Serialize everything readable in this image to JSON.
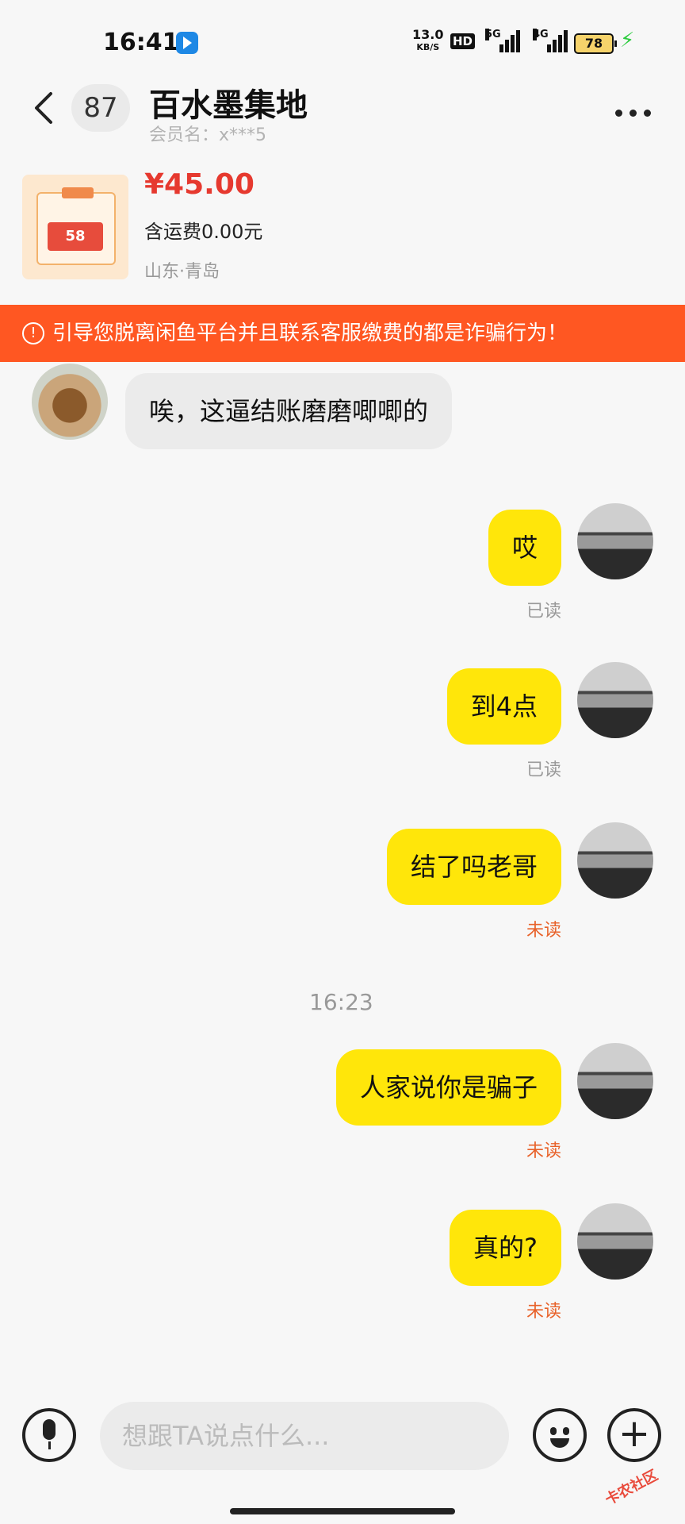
{
  "status_bar": {
    "time": "16:41",
    "net_speed": "13.0",
    "net_unit": "KB/S",
    "hd": "HD",
    "sig1": "5G",
    "sig2": "4G",
    "battery": "78"
  },
  "header": {
    "unread_count": "87",
    "shop_name": "百水墨集地",
    "member_label": "会员名：x***5"
  },
  "product": {
    "price": "¥45.00",
    "shipping": "含运费0.00元",
    "location": "山东·青岛",
    "image_value": "58"
  },
  "warning": {
    "text": "引导您脱离闲鱼平台并且联系客服缴费的都是诈骗行为！"
  },
  "messages": [
    {
      "side": "left",
      "text": "唉，这逼结账磨磨唧唧的"
    },
    {
      "side": "right",
      "text": "哎",
      "status": "已读"
    },
    {
      "side": "right",
      "text": "到4点",
      "status": "已读"
    },
    {
      "side": "right",
      "text": "结了吗老哥",
      "status": "未读"
    },
    {
      "side": "right",
      "text": "人家说你是骗子",
      "status": "未读"
    },
    {
      "side": "right",
      "text": "真的?",
      "status": "未读"
    }
  ],
  "timestamp": "16:23",
  "input": {
    "placeholder": "想跟TA说点什么..."
  },
  "watermark": "卡农社区",
  "colors": {
    "accent": "#ffe60a",
    "warning_bg": "#ff5722",
    "price": "#e6392f",
    "unread": "#e8622a"
  }
}
